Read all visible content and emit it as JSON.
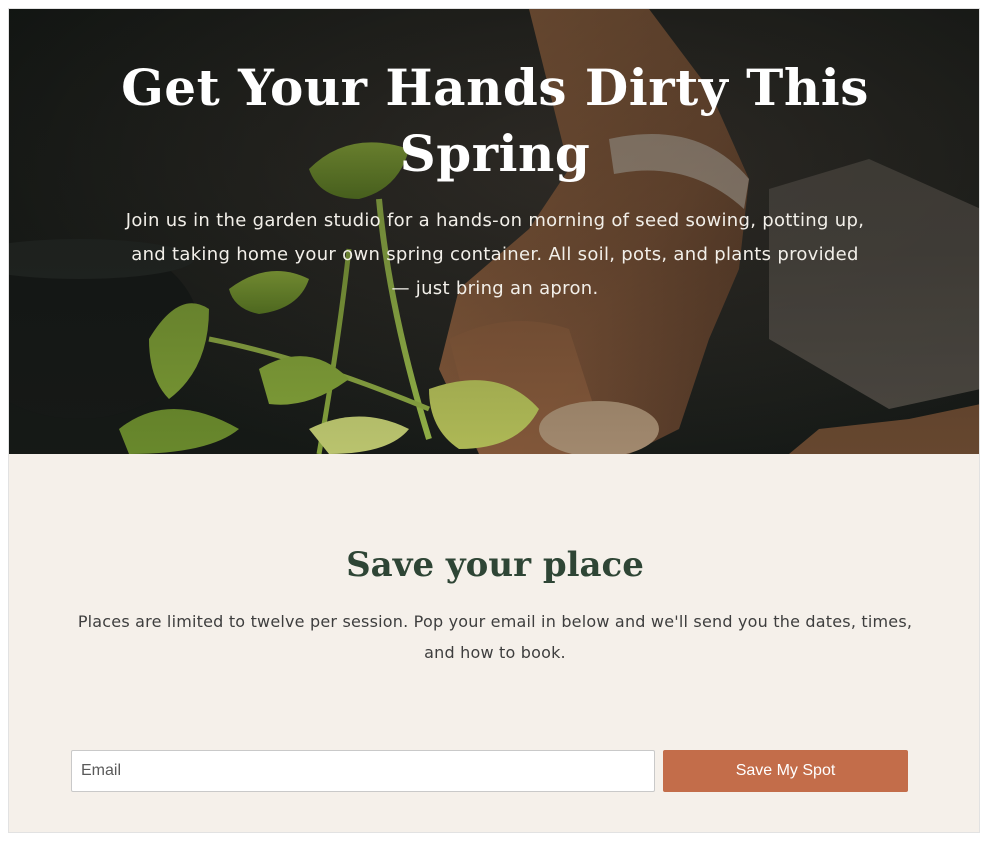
{
  "hero": {
    "title": "Get Your Hands Dirty This Spring",
    "subtitle": "Join us in the garden studio for a hands-on morning of seed sowing, potting up, and taking home your own spring container. All soil, pots, and plants provided — just bring an apron."
  },
  "signup": {
    "title": "Save your place",
    "description": "Places are limited to twelve per session. Pop your email in below and we'll send you the dates, times, and how to book.",
    "email_placeholder": "Email",
    "button_label": "Save My Spot"
  },
  "colors": {
    "page_background": "#f5f0ea",
    "heading_green": "#2e4535",
    "button_terracotta": "#c36d4a",
    "hero_text": "#ffffff"
  }
}
